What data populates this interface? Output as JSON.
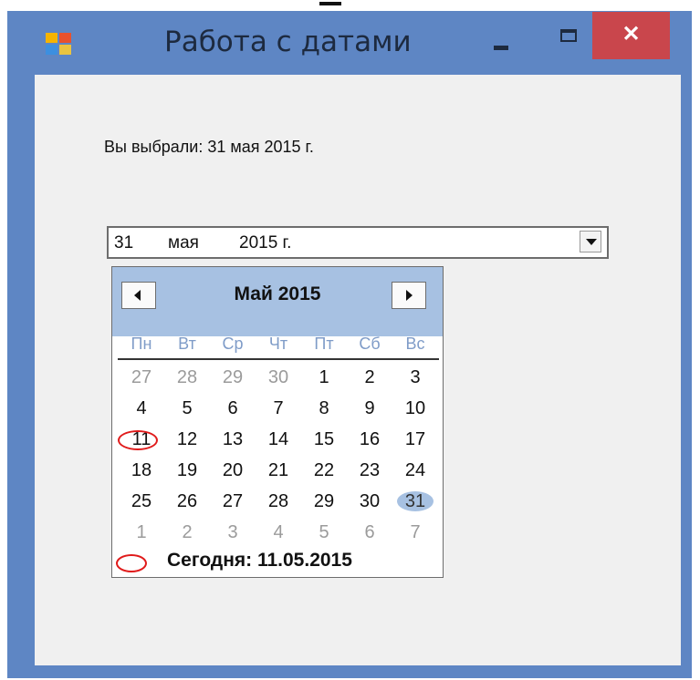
{
  "window": {
    "title": "Работа с датами",
    "close_label": "✕"
  },
  "form": {
    "selected_text": "Вы выбрали: 31 мая 2015 г."
  },
  "date_picker": {
    "day": "31",
    "month": "мая",
    "year": "2015 г."
  },
  "calendar": {
    "month_title": "Май 2015",
    "weekdays": [
      "Пн",
      "Вт",
      "Ср",
      "Чт",
      "Пт",
      "Сб",
      "Вс"
    ],
    "weeks": [
      [
        "27",
        "28",
        "29",
        "30",
        "1",
        "2",
        "3"
      ],
      [
        "4",
        "5",
        "6",
        "7",
        "8",
        "9",
        "10"
      ],
      [
        "11",
        "12",
        "13",
        "14",
        "15",
        "16",
        "17"
      ],
      [
        "18",
        "19",
        "20",
        "21",
        "22",
        "23",
        "24"
      ],
      [
        "25",
        "26",
        "27",
        "28",
        "29",
        "30",
        "31"
      ],
      [
        "1",
        "2",
        "3",
        "4",
        "5",
        "6",
        "7"
      ]
    ],
    "today_label": "Сегодня: 11.05.2015"
  },
  "colors": {
    "title_bar": "#5e86c4",
    "close_button": "#c9464c",
    "calendar_header": "#a7c1e2",
    "weekday_text": "#7f9cc8",
    "annotation_red": "#e01a1a"
  }
}
